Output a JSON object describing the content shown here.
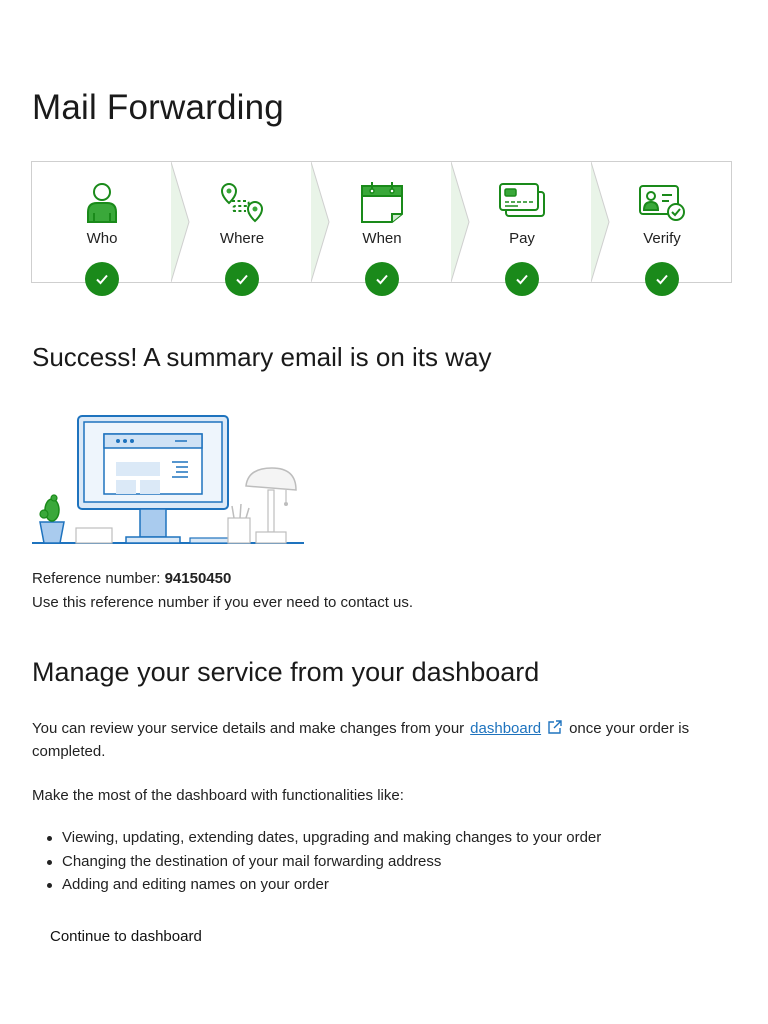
{
  "page": {
    "title": "Mail Forwarding"
  },
  "stepper": {
    "steps": [
      {
        "label": "Who",
        "icon": "person-icon",
        "completed": true
      },
      {
        "label": "Where",
        "icon": "location-route-icon",
        "completed": true
      },
      {
        "label": "When",
        "icon": "calendar-icon",
        "completed": true
      },
      {
        "label": "Pay",
        "icon": "credit-card-icon",
        "completed": true
      },
      {
        "label": "Verify",
        "icon": "id-verify-icon",
        "completed": true
      }
    ],
    "check_color": "#1a8a1a",
    "icon_color": "#1a8a1a"
  },
  "success": {
    "heading": "Success! A summary email is on its way"
  },
  "reference": {
    "label": "Reference number: ",
    "number": "94150450",
    "help": "Use this reference number if you ever need to contact us."
  },
  "manage": {
    "heading": "Manage your service from your dashboard",
    "para_before": "You can review your service details and make changes from your",
    "link_text": "dashboard",
    "para_after": "once your order is completed.",
    "intro": "Make the most of the dashboard with functionalities like:",
    "features": [
      "Viewing, updating, extending dates, upgrading and making changes to your order",
      "Changing the destination of your mail forwarding address",
      "Adding and editing names on your order"
    ],
    "link_color": "#1e73be"
  },
  "actions": {
    "continue_label": "Continue to dashboard"
  }
}
